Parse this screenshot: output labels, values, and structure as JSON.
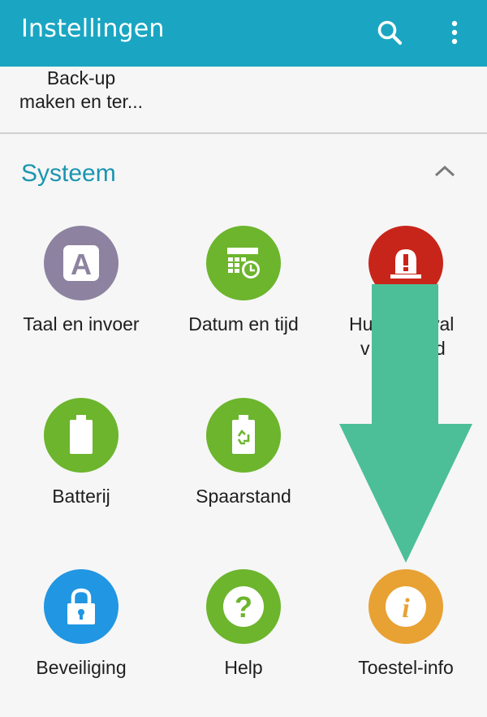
{
  "appbar": {
    "title": "Instellingen",
    "color": "#1aa6c2",
    "search_icon": "search-icon",
    "more_icon": "more-vert-icon"
  },
  "previous_item": {
    "label_line1": "Back-up",
    "label_line2": "maken en ter..."
  },
  "section": {
    "title": "Systeem",
    "collapse_icon": "chevron-up-icon",
    "title_color": "#1a95b0"
  },
  "items": [
    {
      "label": "Taal en invoer",
      "icon": "language-icon",
      "color": "#8d83a0"
    },
    {
      "label": "Datum en tijd",
      "icon": "calendar-clock-icon",
      "color": "#6cb52d"
    },
    {
      "label_line1": "Hu",
      "label_line1_end": "val",
      "label_line2_start": "v",
      "label_line2_end": "d",
      "icon": "alert-siren-icon",
      "color": "#c8251a"
    },
    {
      "label": "Batterij",
      "icon": "battery-icon",
      "color": "#6cb52d"
    },
    {
      "label": "Spaarstand",
      "icon": "power-saving-icon",
      "color": "#6cb52d"
    },
    {
      "label": "Beveiliging",
      "icon": "lock-icon",
      "color": "#2196e3"
    },
    {
      "label": "Help",
      "icon": "help-icon",
      "color": "#6cb52d"
    },
    {
      "label": "Toestel-info",
      "icon": "info-icon",
      "color": "#e8a133"
    }
  ],
  "overlay": {
    "arrow_color": "#4cbf98",
    "arrow_icon": "down-arrow-annotation"
  }
}
